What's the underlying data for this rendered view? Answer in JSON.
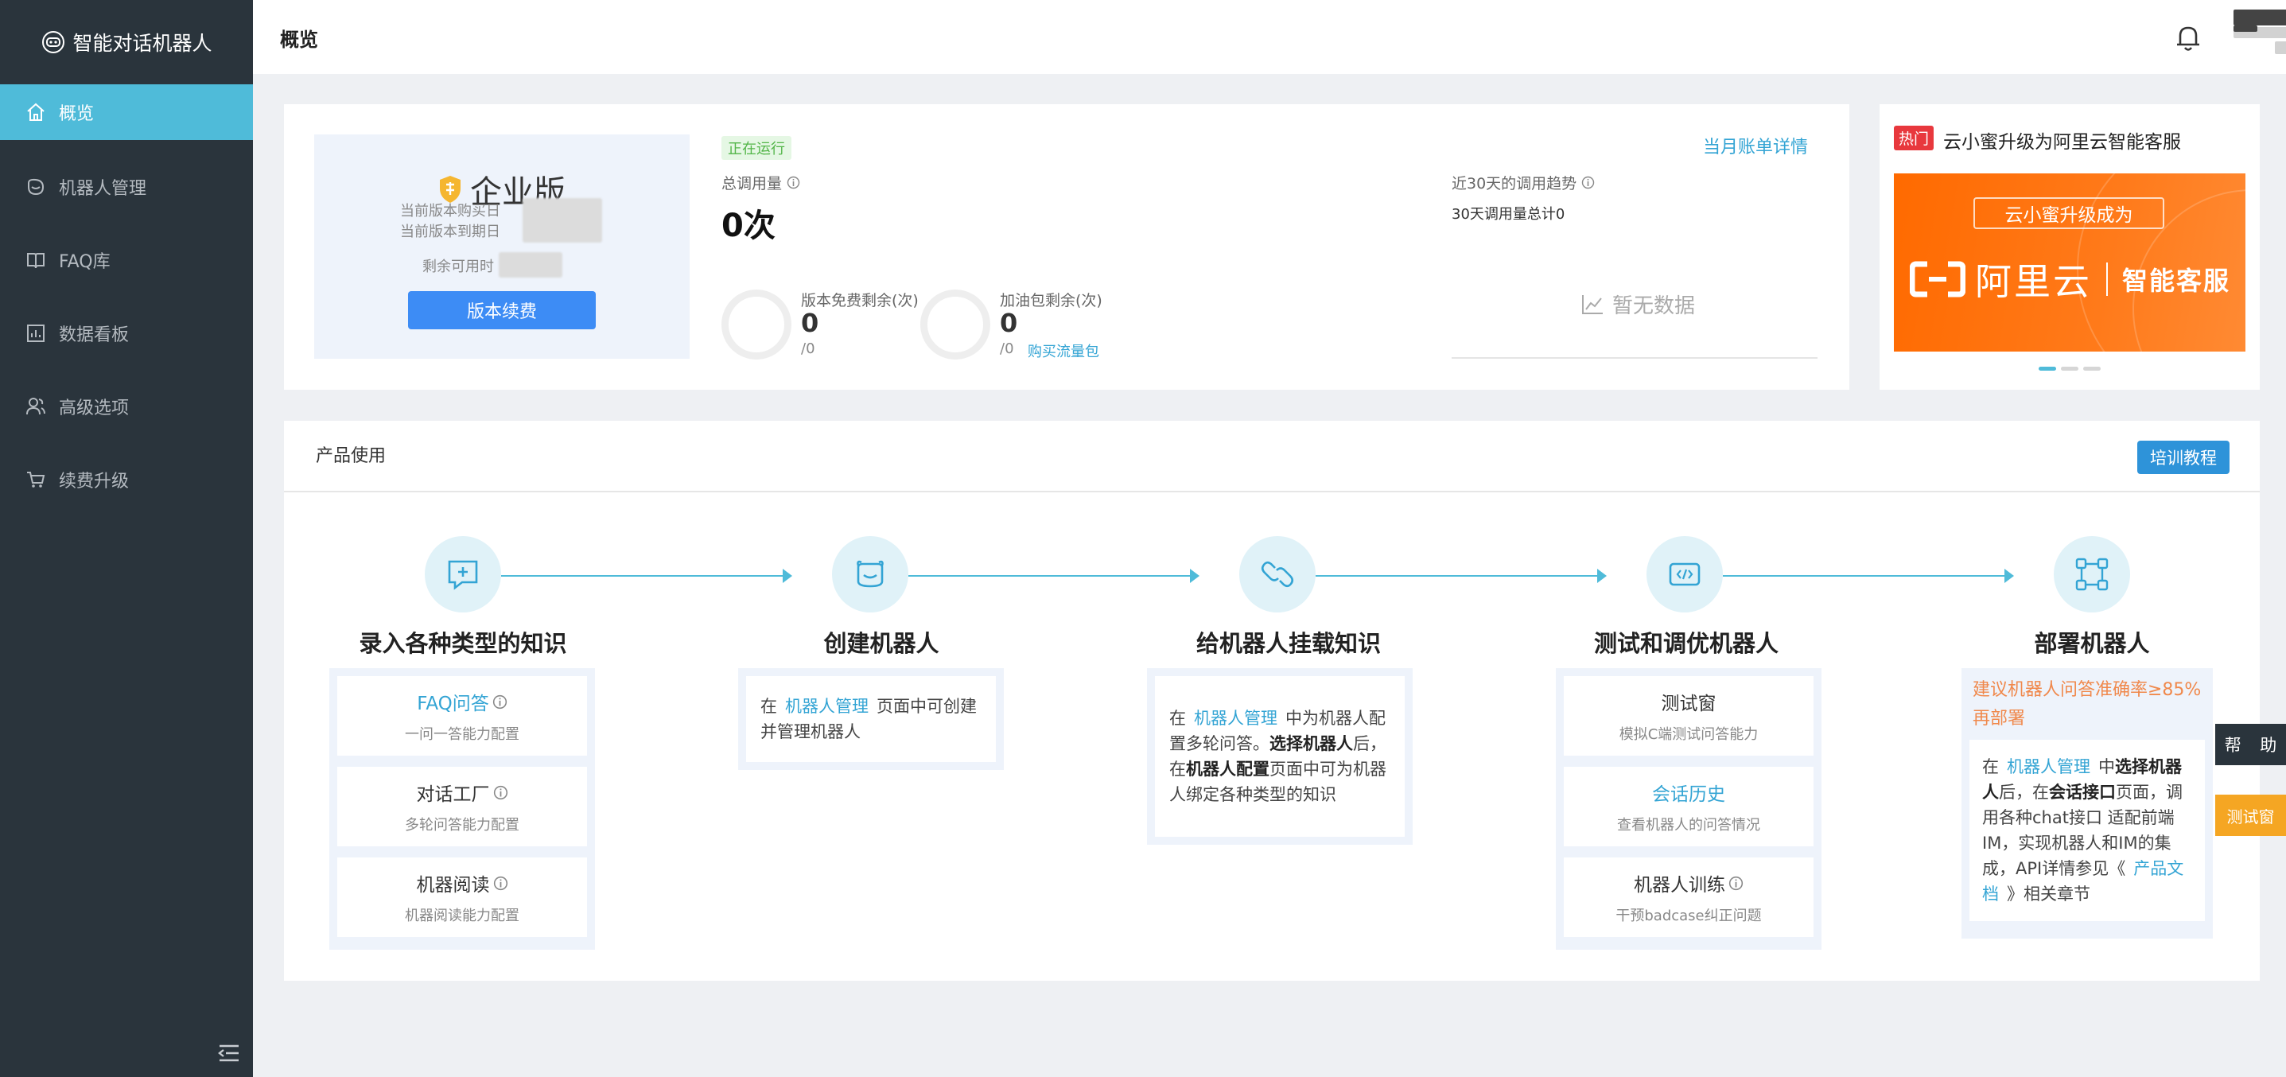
{
  "app": {
    "name": "智能对话机器人"
  },
  "sidebar": {
    "items": [
      {
        "label": "概览",
        "icon": "home-icon"
      },
      {
        "label": "机器人管理",
        "icon": "robot-icon"
      },
      {
        "label": "FAQ库",
        "icon": "book-icon"
      },
      {
        "label": "数据看板",
        "icon": "dashboard-icon"
      },
      {
        "label": "高级选项",
        "icon": "users-icon"
      },
      {
        "label": "续费升级",
        "icon": "cart-icon"
      }
    ]
  },
  "header": {
    "title": "概览"
  },
  "overview": {
    "edition": "企业版",
    "purchase_date_label": "当前版本购买日",
    "expire_date_label": "当前版本到期日",
    "remaining_label": "剩余可用时",
    "renew_label": "版本续费",
    "status": "正在运行",
    "total_calls_label": "总调用量",
    "total_calls_value": "0次",
    "free_left_label": "版本免费剩余(次)",
    "free_left_value": "0",
    "free_left_sub": "/0",
    "addon_left_label": "加油包剩余(次)",
    "addon_left_value": "0",
    "addon_left_sub": "/0",
    "buy_pack_label": "购买流量包",
    "bill_link": "当月账单详情",
    "trend_label": "近30天的调用趋势",
    "trend_total": "30天调用量总计0",
    "no_data": "暂无数据"
  },
  "promo": {
    "badge": "热门",
    "title": "云小蜜升级为阿里云智能客服",
    "banner_pill": "云小蜜升级成为",
    "banner_brand": "阿里云",
    "banner_product": "智能客服",
    "active_slide": 1,
    "slide_count": 3
  },
  "usage": {
    "title": "产品使用",
    "tutorial_button": "培训教程",
    "steps": [
      {
        "title": "录入各种类型的知识",
        "icon": "chat-plus-icon",
        "items": [
          {
            "title": "FAQ问答",
            "desc": "一问一答能力配置"
          },
          {
            "title": "对话工厂",
            "desc": "多轮问答能力配置"
          },
          {
            "title": "机器阅读",
            "desc": "机器阅读能力配置"
          }
        ]
      },
      {
        "title": "创建机器人",
        "icon": "robot-face-icon",
        "text_before": "在",
        "link": "机器人管理",
        "text_after": "页面中可创建并管理机器人"
      },
      {
        "title": "给机器人挂载知识",
        "icon": "link-icon",
        "text_before": "在",
        "link": "机器人管理",
        "text_mid": "中为机器人配置多轮问答。",
        "bold1": "选择机器人",
        "text_mid2": "后，在",
        "bold2": "机器人配置",
        "text_after": "页面中可为机器人绑定各种类型的知识"
      },
      {
        "title": "测试和调优机器人",
        "icon": "code-window-icon",
        "items": [
          {
            "title": "测试窗",
            "desc": "模拟C端测试问答能力"
          },
          {
            "title": "会话历史",
            "desc": "查看机器人的问答情况"
          },
          {
            "title": "机器人训练",
            "desc": "干预badcase纠正问题"
          }
        ]
      },
      {
        "title": "部署机器人",
        "icon": "network-icon",
        "warning": "建议机器人问答准确率≥85%再部署",
        "text_before": "在",
        "link": "机器人管理",
        "text_mid": "中",
        "bold1": "选择机器人",
        "text_mid2": "后，在",
        "bold2": "会话接口",
        "text_mid3": "页面，调用各种chat接口 适配前端IM，实现机器人和IM的集成，API详情参见《",
        "link2": "产品文档",
        "text_after": "》相关章节"
      }
    ]
  },
  "floating": {
    "help": [
      "帮",
      "助"
    ],
    "test": "测试窗"
  },
  "colors": {
    "sidebar_bg": "#2a343c",
    "accent": "#4fbbd9",
    "primary_button": "#3d8cf5",
    "warning": "#f0884b",
    "promo_orange": "#ff6a00"
  }
}
